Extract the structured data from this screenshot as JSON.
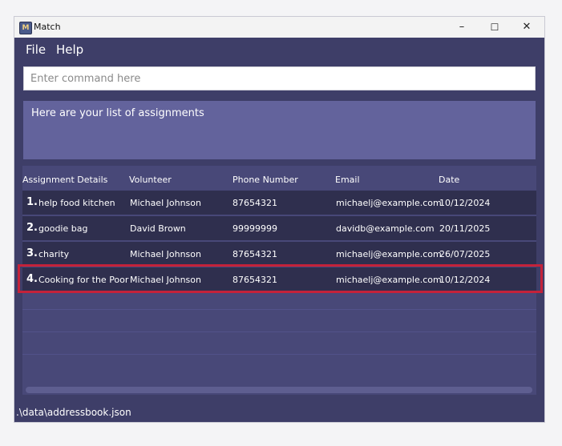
{
  "window": {
    "icon_letter": "M",
    "title": "Match",
    "controls": {
      "minimize": "–",
      "maximize": "☐",
      "close": "✕"
    }
  },
  "menu": {
    "items": [
      "File",
      "Help"
    ]
  },
  "command": {
    "placeholder": "Enter command here",
    "value": ""
  },
  "result": {
    "text": "Here are your list of assignments"
  },
  "table": {
    "headers": [
      "Assignment Details",
      "Volunteer",
      "Phone Number",
      "Email",
      "Date"
    ],
    "rows": [
      {
        "index": "1.",
        "details": "help food kitchen",
        "volunteer": "Michael Johnson",
        "phone": "87654321",
        "email": "michaelj@example.com",
        "date": "10/12/2024"
      },
      {
        "index": "2.",
        "details": "goodie bag",
        "volunteer": "David Brown",
        "phone": "99999999",
        "email": "davidb@example.com",
        "date": "20/11/2025"
      },
      {
        "index": "3.",
        "details": "charity",
        "volunteer": "Michael Johnson",
        "phone": "87654321",
        "email": "michaelj@example.com",
        "date": "26/07/2025"
      },
      {
        "index": "4.",
        "details": "Cooking for the Poor",
        "volunteer": "Michael Johnson",
        "phone": "87654321",
        "email": "michaelj@example.com",
        "date": "10/12/2024"
      }
    ]
  },
  "status": {
    "path": ".\\data\\addressbook.json"
  },
  "colors": {
    "highlight": "#c4223a",
    "panel": "#3e3e68",
    "row": "#2f2f4e"
  }
}
